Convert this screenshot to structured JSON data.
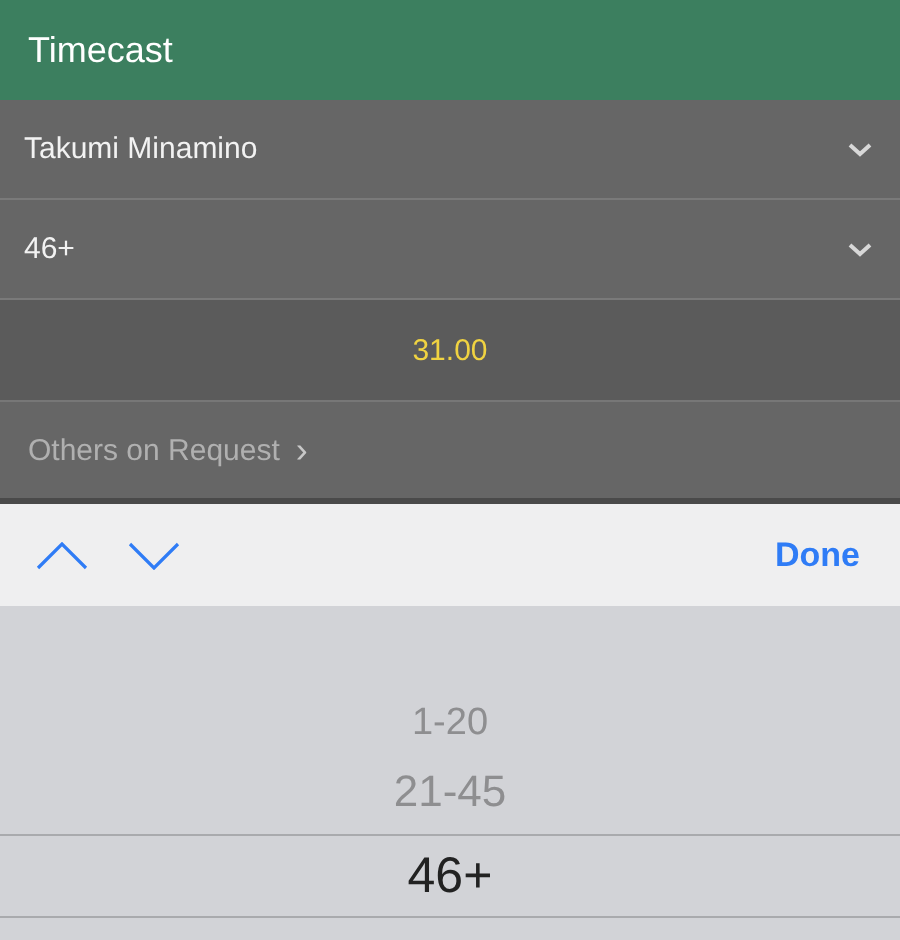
{
  "header": {
    "title": "Timecast"
  },
  "selects": [
    {
      "value": "Takumi Minamino"
    },
    {
      "value": "46+"
    }
  ],
  "odds": "31.00",
  "others_link": {
    "label": "Others on Request",
    "arrow": "›"
  },
  "toolbar": {
    "done": "Done"
  },
  "picker": {
    "options": [
      {
        "label": "1-20",
        "selected": false
      },
      {
        "label": "21-45",
        "selected": false
      },
      {
        "label": "46+",
        "selected": true
      }
    ]
  }
}
